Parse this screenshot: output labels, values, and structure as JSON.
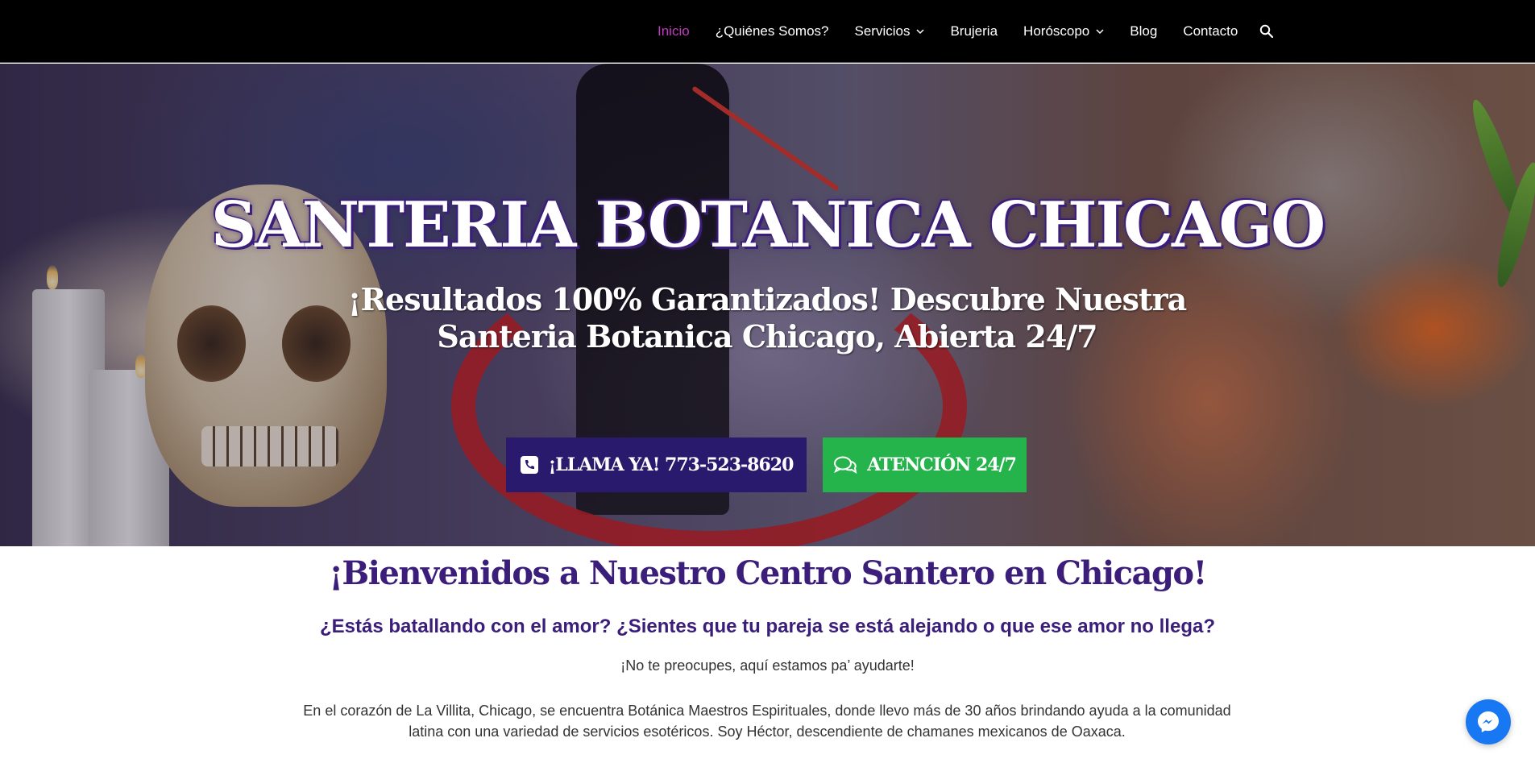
{
  "nav": {
    "items": [
      {
        "label": "Inicio",
        "active": true,
        "dropdown": false
      },
      {
        "label": "¿Quiénes Somos?",
        "active": false,
        "dropdown": false
      },
      {
        "label": "Servicios",
        "active": false,
        "dropdown": true
      },
      {
        "label": "Brujeria",
        "active": false,
        "dropdown": false
      },
      {
        "label": "Horóscopo",
        "active": false,
        "dropdown": true
      },
      {
        "label": "Blog",
        "active": false,
        "dropdown": false
      },
      {
        "label": "Contacto",
        "active": false,
        "dropdown": false
      }
    ],
    "search_icon": "search-icon",
    "active_color": "#c03bbd"
  },
  "hero": {
    "title": "SANTERIA BOTANICA CHICAGO",
    "subtitle": "¡Resultados 100% Garantizados! Descubre Nuestra Santeria Botanica Chicago, Abierta 24/7",
    "call_button": {
      "label": "¡LLAMA YA! 773-523-8620",
      "icon": "phone-icon",
      "color": "#2a1a6e"
    },
    "chat_button": {
      "label": "ATENCIÓN 24/7",
      "icon": "chat-icon",
      "color": "#25b34b"
    }
  },
  "content": {
    "welcome": "¡Bienvenidos a Nuestro Centro Santero en Chicago!",
    "question": "¿Estás batallando con el amor? ¿Sientes que tu pareja se está alejando o que ese amor no llega?",
    "reassure": "¡No te preocupes, aquí estamos pa’ ayudarte!",
    "intro": "En el corazón de La Villita, Chicago, se encuentra Botánica Maestros Espirituales, donde llevo más de 30 años brindando ayuda a la comunidad latina con una variedad de servicios esotéricos. Soy Héctor, descendiente de chamanes mexicanos de Oaxaca.",
    "accent_color": "#3b1d7a"
  },
  "messenger": {
    "icon": "messenger-icon",
    "color": "#1877f2"
  }
}
